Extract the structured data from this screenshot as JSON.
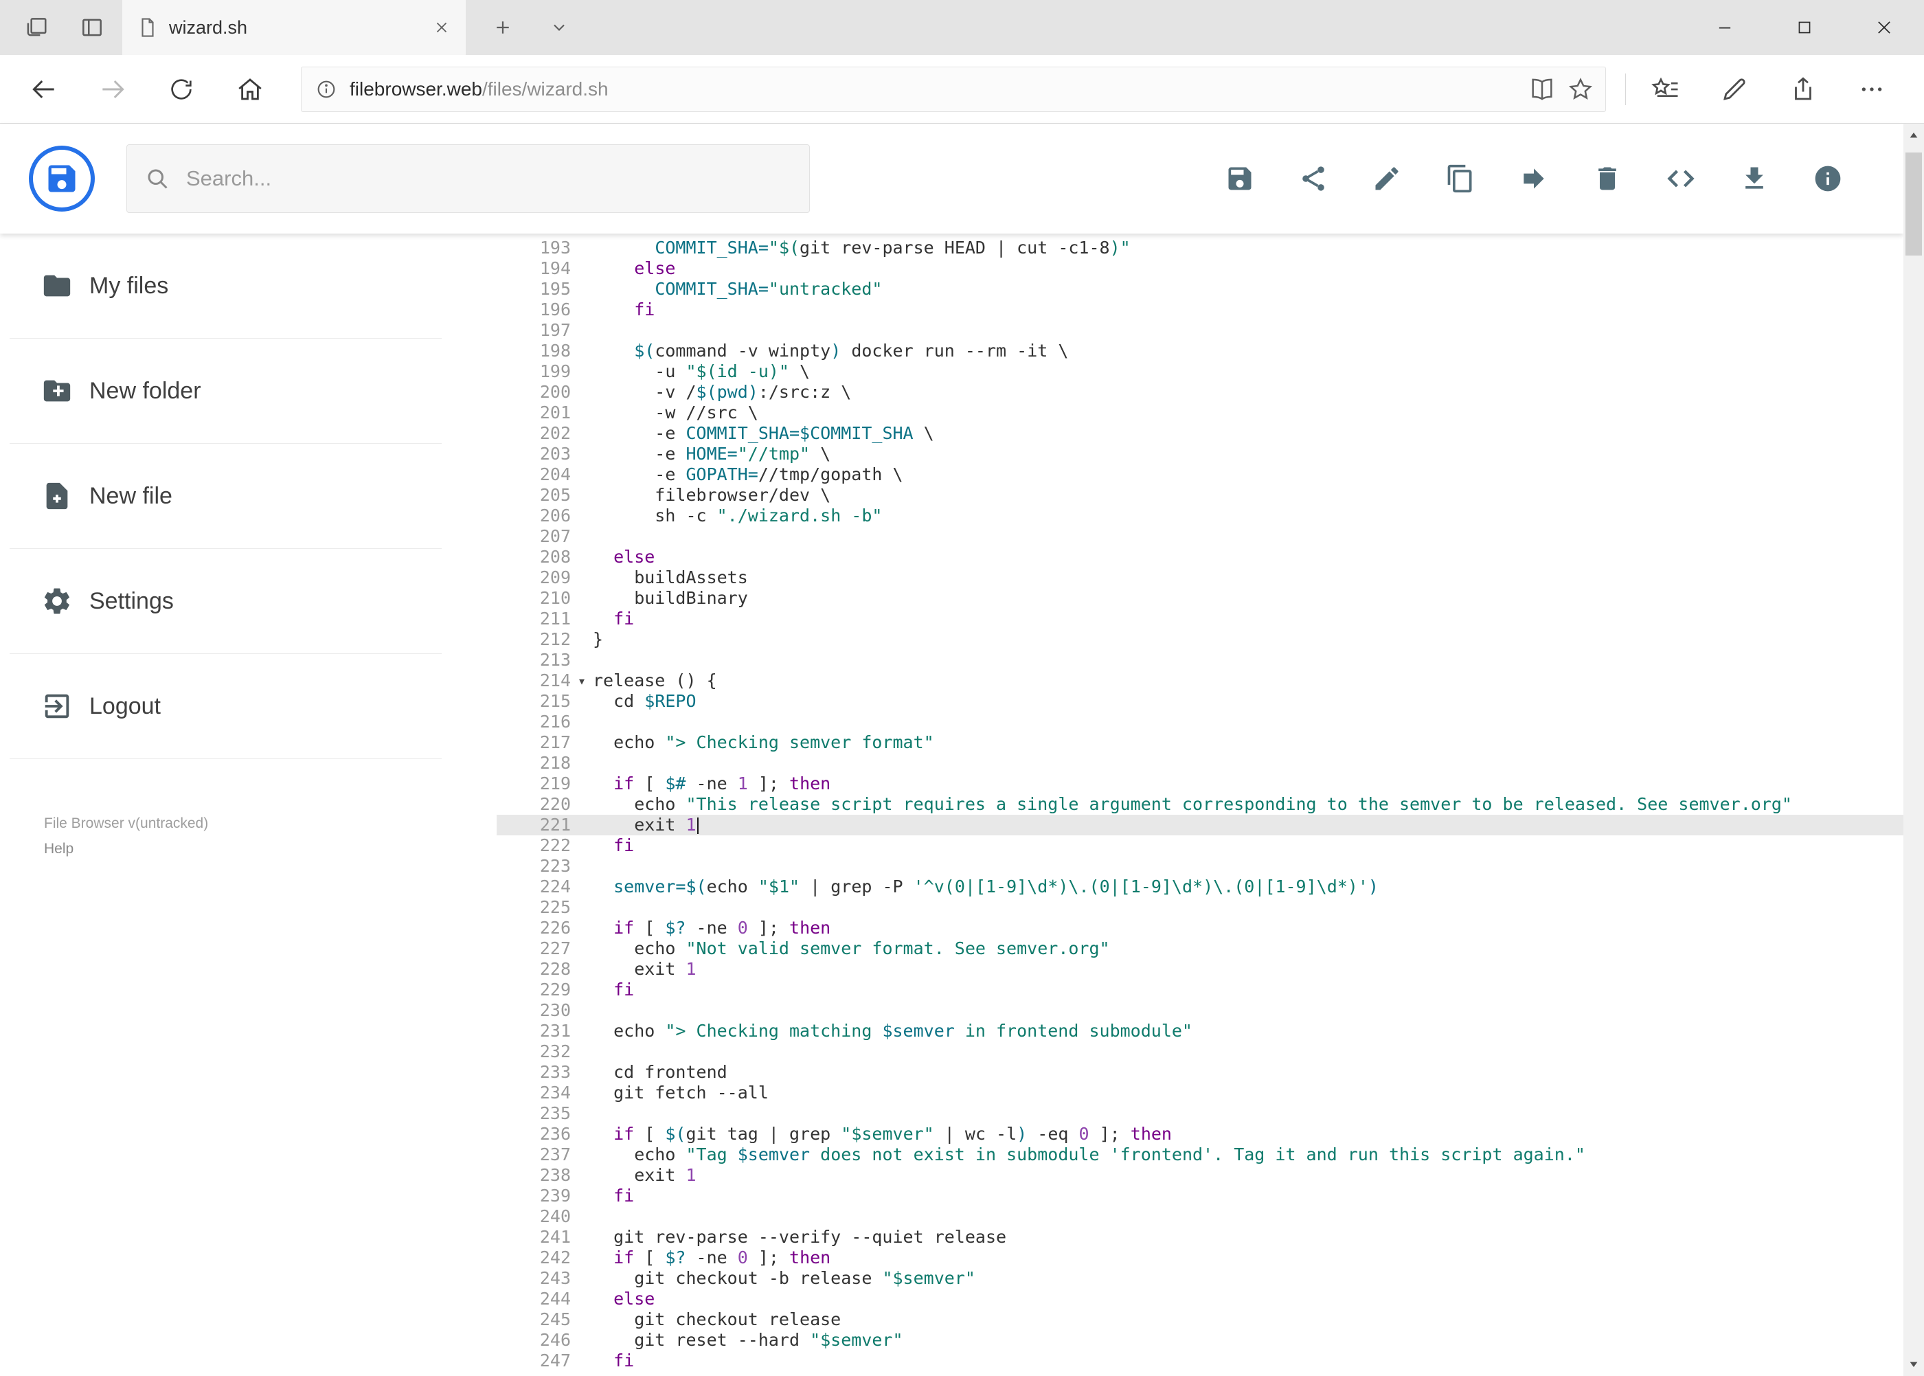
{
  "browser": {
    "tab_title": "wizard.sh",
    "url_host": "filebrowser.web",
    "url_path": "/files/wizard.sh"
  },
  "app": {
    "search_placeholder": "Search...",
    "toolbar_icons": [
      "save-icon",
      "share-icon",
      "edit-icon",
      "copy-icon",
      "move-icon",
      "delete-icon",
      "code-icon",
      "download-icon",
      "info-icon"
    ]
  },
  "sidebar": {
    "items": [
      {
        "label": "My files",
        "icon": "folder-icon"
      },
      {
        "label": "New folder",
        "icon": "new-folder-icon"
      },
      {
        "label": "New file",
        "icon": "new-file-icon"
      },
      {
        "label": "Settings",
        "icon": "gear-icon"
      },
      {
        "label": "Logout",
        "icon": "logout-icon"
      }
    ],
    "footer_version": "File Browser v(untracked)",
    "footer_help": "Help"
  },
  "editor": {
    "active_line": 221,
    "fold_line": 214,
    "lines": [
      {
        "n": 193,
        "seg": [
          [
            "p",
            "      "
          ],
          [
            "v",
            "COMMIT_SHA="
          ],
          [
            "s",
            "\"$("
          ],
          [
            "p",
            "git rev-parse HEAD | cut -c1-8"
          ],
          [
            "s",
            ")\""
          ]
        ]
      },
      {
        "n": 194,
        "seg": [
          [
            "p",
            "    "
          ],
          [
            "k",
            "else"
          ]
        ]
      },
      {
        "n": 195,
        "seg": [
          [
            "p",
            "      "
          ],
          [
            "v",
            "COMMIT_SHA="
          ],
          [
            "s",
            "\"untracked\""
          ]
        ]
      },
      {
        "n": 196,
        "seg": [
          [
            "p",
            "    "
          ],
          [
            "k",
            "fi"
          ]
        ]
      },
      {
        "n": 197,
        "seg": []
      },
      {
        "n": 198,
        "seg": [
          [
            "p",
            "    "
          ],
          [
            "v",
            "$("
          ],
          [
            "p",
            "command -v winpty"
          ],
          [
            "v",
            ")"
          ],
          [
            "p",
            " docker run --rm -it \\"
          ]
        ]
      },
      {
        "n": 199,
        "seg": [
          [
            "p",
            "      -u "
          ],
          [
            "s",
            "\"$(id -u)\""
          ],
          [
            "p",
            " \\"
          ]
        ]
      },
      {
        "n": 200,
        "seg": [
          [
            "p",
            "      -v /"
          ],
          [
            "v",
            "$(pwd)"
          ],
          [
            "p",
            ":/src:z \\"
          ]
        ]
      },
      {
        "n": 201,
        "seg": [
          [
            "p",
            "      -w //src \\"
          ]
        ]
      },
      {
        "n": 202,
        "seg": [
          [
            "p",
            "      -e "
          ],
          [
            "v",
            "COMMIT_SHA=$COMMIT_SHA"
          ],
          [
            "p",
            " \\"
          ]
        ]
      },
      {
        "n": 203,
        "seg": [
          [
            "p",
            "      -e "
          ],
          [
            "v",
            "HOME="
          ],
          [
            "s",
            "\"//tmp\""
          ],
          [
            "p",
            " \\"
          ]
        ]
      },
      {
        "n": 204,
        "seg": [
          [
            "p",
            "      -e "
          ],
          [
            "v",
            "GOPATH="
          ],
          [
            "p",
            "//tmp/gopath \\"
          ]
        ]
      },
      {
        "n": 205,
        "seg": [
          [
            "p",
            "      filebrowser/dev \\"
          ]
        ]
      },
      {
        "n": 206,
        "seg": [
          [
            "p",
            "      sh -c "
          ],
          [
            "s",
            "\"./wizard.sh -b\""
          ]
        ]
      },
      {
        "n": 207,
        "seg": []
      },
      {
        "n": 208,
        "seg": [
          [
            "p",
            "  "
          ],
          [
            "k",
            "else"
          ]
        ]
      },
      {
        "n": 209,
        "seg": [
          [
            "p",
            "    buildAssets"
          ]
        ]
      },
      {
        "n": 210,
        "seg": [
          [
            "p",
            "    buildBinary"
          ]
        ]
      },
      {
        "n": 211,
        "seg": [
          [
            "p",
            "  "
          ],
          [
            "k",
            "fi"
          ]
        ]
      },
      {
        "n": 212,
        "seg": [
          [
            "p",
            "}"
          ]
        ]
      },
      {
        "n": 213,
        "seg": []
      },
      {
        "n": 214,
        "seg": [
          [
            "p",
            "release () {"
          ]
        ]
      },
      {
        "n": 215,
        "seg": [
          [
            "p",
            "  cd "
          ],
          [
            "v",
            "$REPO"
          ]
        ]
      },
      {
        "n": 216,
        "seg": []
      },
      {
        "n": 217,
        "seg": [
          [
            "p",
            "  echo "
          ],
          [
            "s",
            "\"> Checking semver format\""
          ]
        ]
      },
      {
        "n": 218,
        "seg": []
      },
      {
        "n": 219,
        "seg": [
          [
            "p",
            "  "
          ],
          [
            "k",
            "if"
          ],
          [
            "p",
            " [ "
          ],
          [
            "v",
            "$#"
          ],
          [
            "p",
            " -ne "
          ],
          [
            "n",
            "1"
          ],
          [
            "p",
            " ]; "
          ],
          [
            "k",
            "then"
          ]
        ]
      },
      {
        "n": 220,
        "seg": [
          [
            "p",
            "    echo "
          ],
          [
            "s",
            "\"This release script requires a single argument corresponding to the semver to be released. See semver.org\""
          ]
        ]
      },
      {
        "n": 221,
        "seg": [
          [
            "p",
            "    exit "
          ],
          [
            "n",
            "1"
          ]
        ]
      },
      {
        "n": 222,
        "seg": [
          [
            "p",
            "  "
          ],
          [
            "k",
            "fi"
          ]
        ]
      },
      {
        "n": 223,
        "seg": []
      },
      {
        "n": 224,
        "seg": [
          [
            "p",
            "  "
          ],
          [
            "v",
            "semver="
          ],
          [
            "v",
            "$("
          ],
          [
            "p",
            "echo "
          ],
          [
            "s",
            "\"$1\""
          ],
          [
            "p",
            " | grep -P "
          ],
          [
            "s",
            "'^v(0|[1-9]\\d*)\\.(0|[1-9]\\d*)\\.(0|[1-9]\\d*)'"
          ],
          [
            "v",
            ")"
          ]
        ]
      },
      {
        "n": 225,
        "seg": []
      },
      {
        "n": 226,
        "seg": [
          [
            "p",
            "  "
          ],
          [
            "k",
            "if"
          ],
          [
            "p",
            " [ "
          ],
          [
            "v",
            "$?"
          ],
          [
            "p",
            " -ne "
          ],
          [
            "n",
            "0"
          ],
          [
            "p",
            " ]; "
          ],
          [
            "k",
            "then"
          ]
        ]
      },
      {
        "n": 227,
        "seg": [
          [
            "p",
            "    echo "
          ],
          [
            "s",
            "\"Not valid semver format. See semver.org\""
          ]
        ]
      },
      {
        "n": 228,
        "seg": [
          [
            "p",
            "    exit "
          ],
          [
            "n",
            "1"
          ]
        ]
      },
      {
        "n": 229,
        "seg": [
          [
            "p",
            "  "
          ],
          [
            "k",
            "fi"
          ]
        ]
      },
      {
        "n": 230,
        "seg": []
      },
      {
        "n": 231,
        "seg": [
          [
            "p",
            "  echo "
          ],
          [
            "s",
            "\"> Checking matching "
          ],
          [
            "v",
            "$semver"
          ],
          [
            "s",
            " in frontend submodule\""
          ]
        ]
      },
      {
        "n": 232,
        "seg": []
      },
      {
        "n": 233,
        "seg": [
          [
            "p",
            "  cd frontend"
          ]
        ]
      },
      {
        "n": 234,
        "seg": [
          [
            "p",
            "  git fetch --all"
          ]
        ]
      },
      {
        "n": 235,
        "seg": []
      },
      {
        "n": 236,
        "seg": [
          [
            "p",
            "  "
          ],
          [
            "k",
            "if"
          ],
          [
            "p",
            " [ "
          ],
          [
            "v",
            "$("
          ],
          [
            "p",
            "git tag | grep "
          ],
          [
            "s",
            "\"$semver\""
          ],
          [
            "p",
            " | wc -l"
          ],
          [
            "v",
            ")"
          ],
          [
            "p",
            " -eq "
          ],
          [
            "n",
            "0"
          ],
          [
            "p",
            " ]; "
          ],
          [
            "k",
            "then"
          ]
        ]
      },
      {
        "n": 237,
        "seg": [
          [
            "p",
            "    echo "
          ],
          [
            "s",
            "\"Tag "
          ],
          [
            "v",
            "$semver"
          ],
          [
            "s",
            " does not exist in submodule 'frontend'. Tag it and run this script again.\""
          ]
        ]
      },
      {
        "n": 238,
        "seg": [
          [
            "p",
            "    exit "
          ],
          [
            "n",
            "1"
          ]
        ]
      },
      {
        "n": 239,
        "seg": [
          [
            "p",
            "  "
          ],
          [
            "k",
            "fi"
          ]
        ]
      },
      {
        "n": 240,
        "seg": []
      },
      {
        "n": 241,
        "seg": [
          [
            "p",
            "  git rev-parse --verify --quiet release"
          ]
        ]
      },
      {
        "n": 242,
        "seg": [
          [
            "p",
            "  "
          ],
          [
            "k",
            "if"
          ],
          [
            "p",
            " [ "
          ],
          [
            "v",
            "$?"
          ],
          [
            "p",
            " -ne "
          ],
          [
            "n",
            "0"
          ],
          [
            "p",
            " ]; "
          ],
          [
            "k",
            "then"
          ]
        ]
      },
      {
        "n": 243,
        "seg": [
          [
            "p",
            "    git checkout -b release "
          ],
          [
            "s",
            "\"$semver\""
          ]
        ]
      },
      {
        "n": 244,
        "seg": [
          [
            "p",
            "  "
          ],
          [
            "k",
            "else"
          ]
        ]
      },
      {
        "n": 245,
        "seg": [
          [
            "p",
            "    git checkout release"
          ]
        ]
      },
      {
        "n": 246,
        "seg": [
          [
            "p",
            "    git reset --hard "
          ],
          [
            "s",
            "\"$semver\""
          ]
        ]
      },
      {
        "n": 247,
        "seg": [
          [
            "p",
            "  "
          ],
          [
            "k",
            "fi"
          ]
        ]
      }
    ]
  },
  "colors": {
    "keyword": "#770088",
    "string": "#0f7b6c",
    "variable": "#0b7285",
    "number": "#8e44ad",
    "plain": "#333333",
    "accent_blue": "#2571e8",
    "active_line_bg": "#e8e8e8"
  }
}
